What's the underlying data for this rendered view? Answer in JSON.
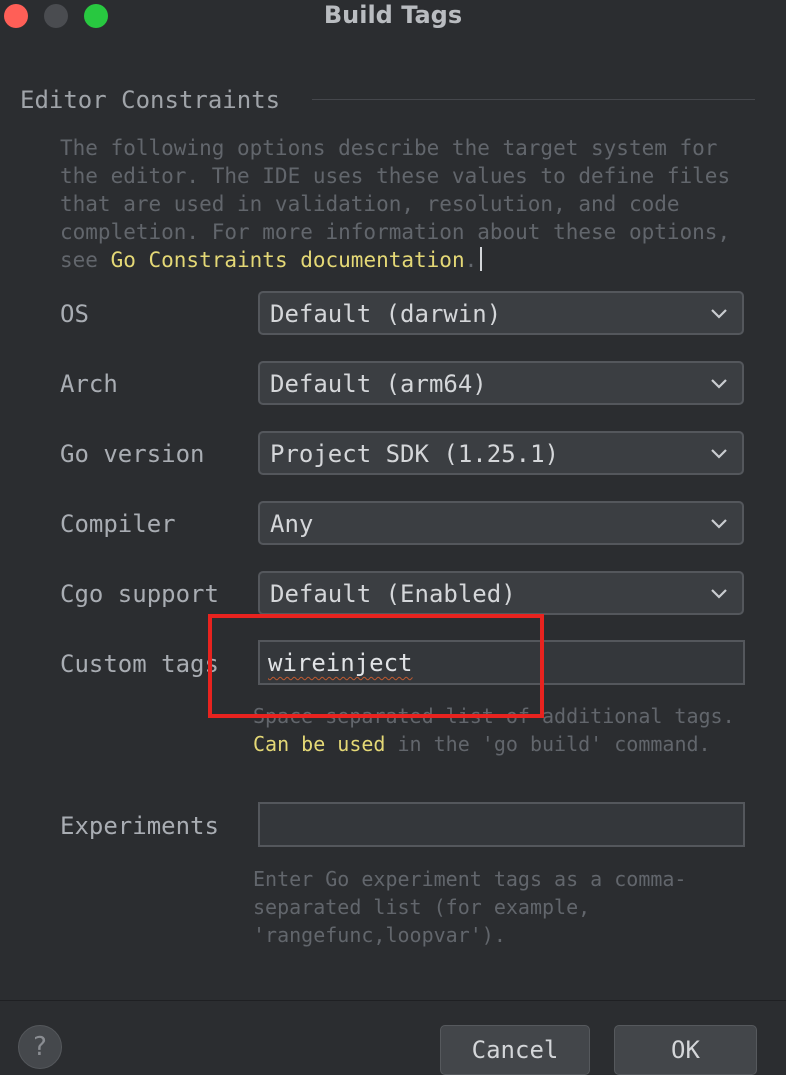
{
  "window": {
    "title": "Build Tags"
  },
  "section": {
    "title": "Editor Constraints",
    "description_before": "The following options describe the target system for the editor. The IDE uses these values to define files that are used in validation, resolution, and code completion. For more information about these options, see ",
    "description_link": "Go Constraints documentation",
    "description_after": "."
  },
  "fields": {
    "os": {
      "label": "OS",
      "value": "Default (darwin)"
    },
    "arch": {
      "label": "Arch",
      "value": "Default (arm64)"
    },
    "go_version": {
      "label": "Go version",
      "value": "Project SDK (1.25.1)"
    },
    "compiler": {
      "label": "Compiler",
      "value": "Any"
    },
    "cgo": {
      "label": "Cgo support",
      "value": "Default (Enabled)"
    },
    "custom_tags": {
      "label": "Custom tags",
      "value": "wireinject",
      "hint_before": "Space separated list of additional tags. ",
      "hint_link": "Can be used",
      "hint_after": " in the 'go build' command."
    },
    "experiments": {
      "label": "Experiments",
      "value": "",
      "hint": "Enter Go experiment tags as a comma-separated list (for example, 'rangefunc,loopvar')."
    }
  },
  "footer": {
    "help_label": "?",
    "cancel_label": "Cancel",
    "ok_label": "OK"
  },
  "colors": {
    "background": "#2b2d30",
    "link": "#e4d876",
    "highlight_box": "#e8231f"
  },
  "icons": {
    "dropdown": "chevron-down-icon",
    "help": "help-icon"
  }
}
